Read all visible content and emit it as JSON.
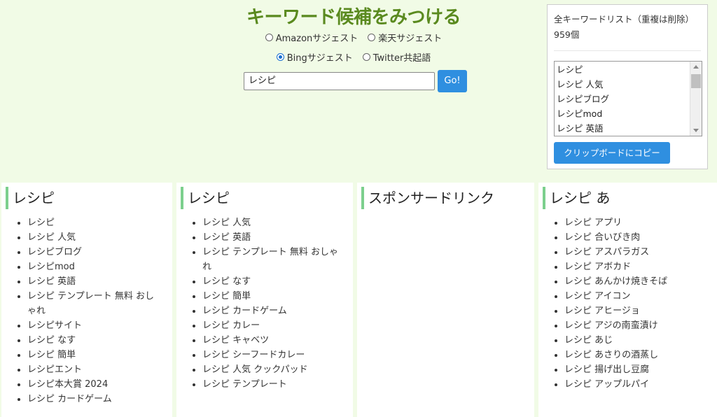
{
  "header": {
    "title": "キーワード候補をみつける"
  },
  "sources": [
    {
      "label": "Amazonサジェスト",
      "checked": false
    },
    {
      "label": "楽天サジェスト",
      "checked": false
    },
    {
      "label": "Bingサジェスト",
      "checked": true
    },
    {
      "label": "Twitter共起語",
      "checked": false
    }
  ],
  "search": {
    "value": "レシピ",
    "go_label": "Go!"
  },
  "keyword_panel": {
    "label": "全キーワードリスト（重複は削除）",
    "count": "959個",
    "items": [
      "レシピ",
      "レシピ 人気",
      "レシピブログ",
      "レシピmod",
      "レシピ 英語"
    ],
    "copy_label": "クリップボードにコピー"
  },
  "columns": [
    {
      "heading": "レシピ",
      "items": [
        "レシピ",
        "レシピ 人気",
        "レシピブログ",
        "レシピmod",
        "レシピ 英語",
        "レシピ テンプレート 無料 おしゃれ",
        "レシピサイト",
        "レシピ なす",
        "レシピ 簡単",
        "レシピエント",
        "レシピ本大賞 2024",
        "レシピ カードゲーム"
      ]
    },
    {
      "heading": "レシピ",
      "items": [
        "レシピ 人気",
        "レシピ 英語",
        "レシピ テンプレート 無料 おしゃれ",
        "レシピ なす",
        "レシピ 簡単",
        "レシピ カードゲーム",
        "レシピ カレー",
        "レシピ キャベツ",
        "レシピ シーフードカレー",
        "レシピ 人気 クックパッド",
        "レシピ テンプレート"
      ]
    },
    {
      "heading": "スポンサードリンク",
      "items": []
    },
    {
      "heading": "レシピ あ",
      "items": [
        "レシピ アプリ",
        "レシピ 合いびき肉",
        "レシピ アスパラガス",
        "レシピ アボカド",
        "レシピ あんかけ焼きそば",
        "レシピ アイコン",
        "レシピ アヒージョ",
        "レシピ アジの南蛮漬け",
        "レシピ あじ",
        "レシピ あさりの酒蒸し",
        "レシピ 揚げ出し豆腐",
        "レシピ アップルパイ"
      ]
    }
  ]
}
